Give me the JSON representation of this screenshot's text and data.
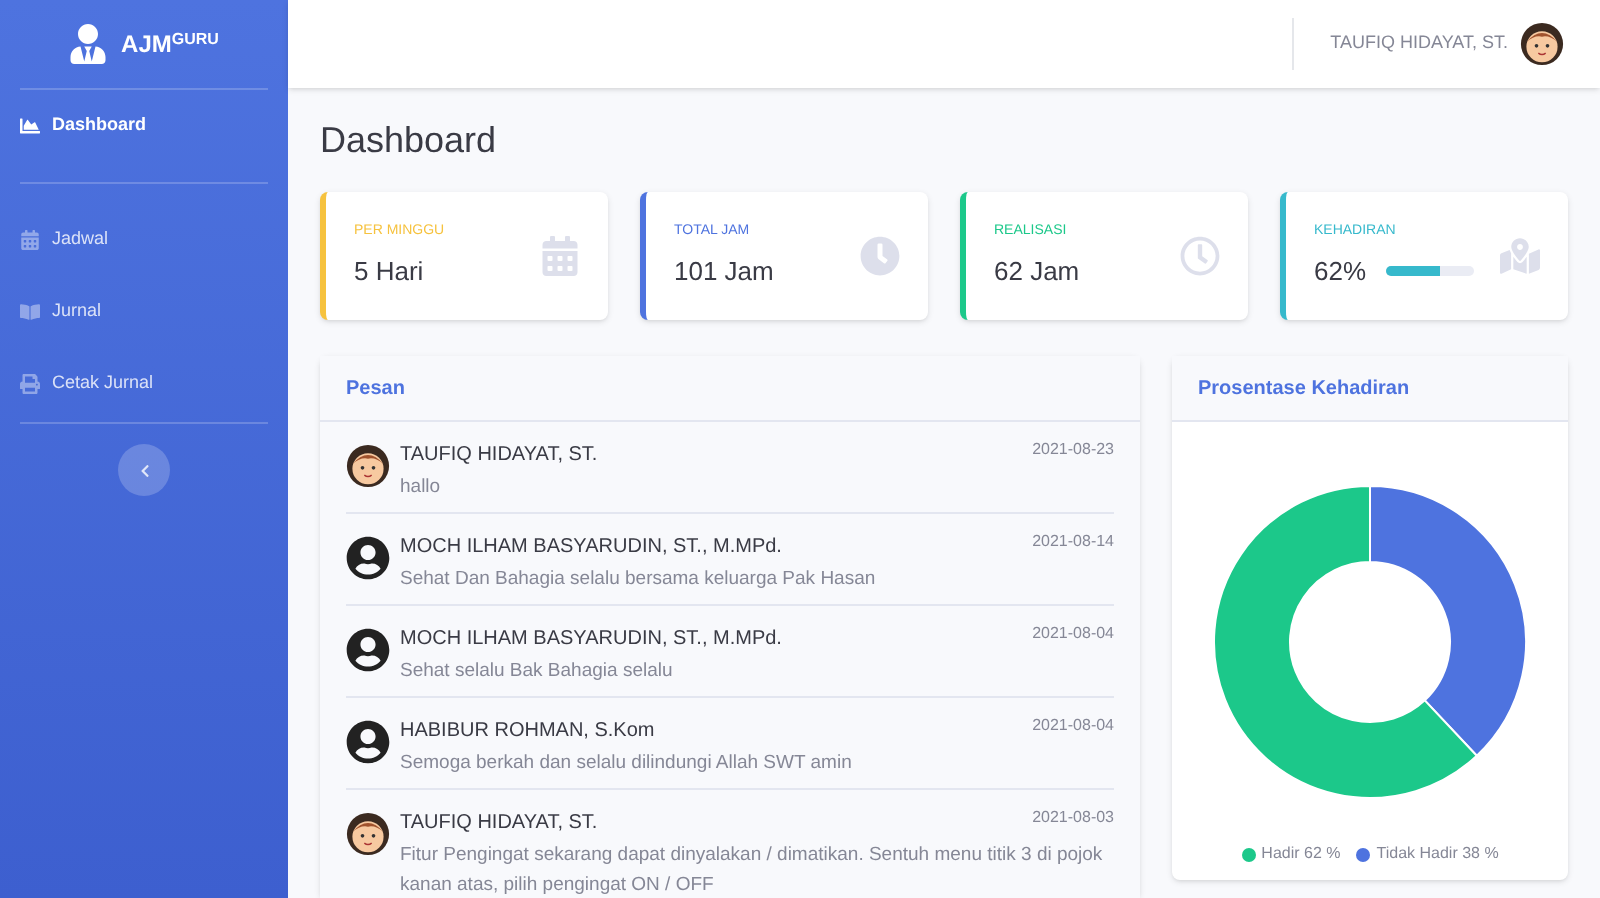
{
  "brand": {
    "name": "AJM",
    "sup": "GURU"
  },
  "sidebar": {
    "items": [
      {
        "label": "Dashboard",
        "selected": true
      },
      {
        "label": "Jadwal",
        "selected": false
      },
      {
        "label": "Jurnal",
        "selected": false
      },
      {
        "label": "Cetak Jurnal",
        "selected": false
      }
    ]
  },
  "topbar": {
    "user": "TAUFIQ HIDAYAT, ST."
  },
  "page_title": "Dashboard",
  "cards": [
    {
      "label": "PER MINGGU",
      "value": "5 Hari",
      "color": "#f6c23e"
    },
    {
      "label": "TOTAL JAM",
      "value": "101 Jam",
      "color": "#4e73df"
    },
    {
      "label": "REALISASI",
      "value": "62 Jam",
      "color": "#1cc88a"
    },
    {
      "label": "KEHADIRAN",
      "value": "62%",
      "color": "#36b9cc",
      "level": 0.62
    }
  ],
  "messages": {
    "title": "Pesan",
    "items": [
      {
        "sender": "TAUFIQ HIDAYAT, ST.",
        "date": "2021-08-23",
        "text": "hallo",
        "kind": "cartoon"
      },
      {
        "sender": "MOCH ILHAM BASYARUDIN, ST., M.MPd.",
        "date": "2021-08-14",
        "text": "Sehat Dan Bahagia selalu bersama keluarga Pak Hasan",
        "kind": "default"
      },
      {
        "sender": "MOCH ILHAM BASYARUDIN, ST., M.MPd.",
        "date": "2021-08-04",
        "text": "Sehat selalu Bak Bahagia selalu",
        "kind": "default"
      },
      {
        "sender": "HABIBUR ROHMAN, S.Kom",
        "date": "2021-08-04",
        "text": "Semoga berkah dan selalu dilindungi Allah SWT amin",
        "kind": "default"
      },
      {
        "sender": "TAUFIQ HIDAYAT, ST.",
        "date": "2021-08-03",
        "text": "Fitur Pengingat sekarang dapat dinyalakan / dimatikan. Sentuh menu titik 3 di pojok kanan atas, pilih pengingat ON / OFF",
        "kind": "cartoon"
      }
    ]
  },
  "attendance": {
    "title": "Prosentase Kehadiran",
    "chart_data": {
      "type": "donut",
      "categories": [
        "Hadir 62 %",
        "Tidak Hadir 38 %"
      ],
      "series": [
        {
          "colors": [
            "#1cc88a",
            "#4e73df"
          ],
          "values": [
            62,
            38
          ]
        }
      ],
      "legend": "bottom"
    }
  }
}
